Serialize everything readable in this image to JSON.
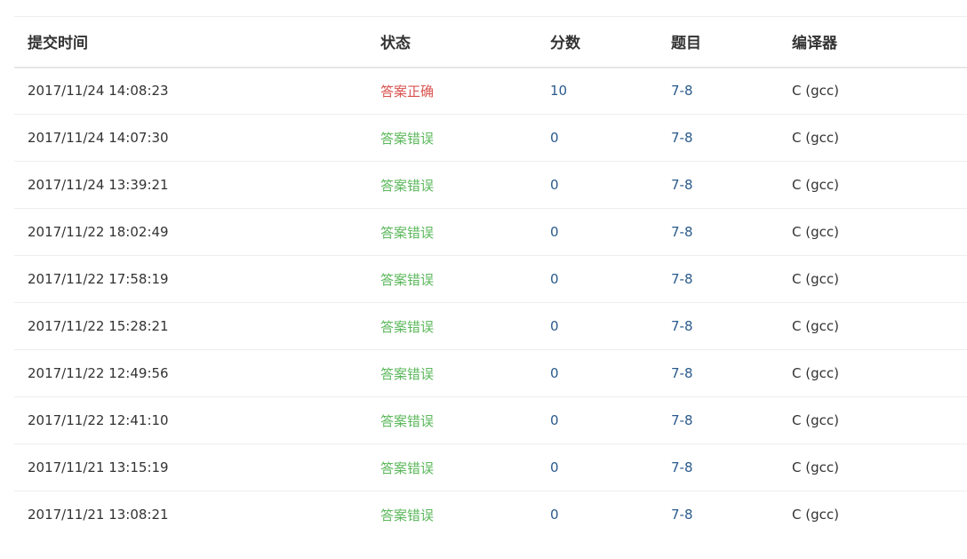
{
  "colors": {
    "accepted": "#d9534f",
    "wrong_answer": "#5cb85c",
    "link": "#2a5a8c"
  },
  "table": {
    "headers": [
      "提交时间",
      "状态",
      "分数",
      "题目",
      "编译器"
    ],
    "rows": [
      {
        "time": "2017/11/24 14:08:23",
        "status": "答案正确",
        "status_type": "accepted",
        "score": "10",
        "problem": "7-8",
        "compiler": "C (gcc)"
      },
      {
        "time": "2017/11/24 14:07:30",
        "status": "答案错误",
        "status_type": "wrong_answer",
        "score": "0",
        "problem": "7-8",
        "compiler": "C (gcc)"
      },
      {
        "time": "2017/11/24 13:39:21",
        "status": "答案错误",
        "status_type": "wrong_answer",
        "score": "0",
        "problem": "7-8",
        "compiler": "C (gcc)"
      },
      {
        "time": "2017/11/22 18:02:49",
        "status": "答案错误",
        "status_type": "wrong_answer",
        "score": "0",
        "problem": "7-8",
        "compiler": "C (gcc)"
      },
      {
        "time": "2017/11/22 17:58:19",
        "status": "答案错误",
        "status_type": "wrong_answer",
        "score": "0",
        "problem": "7-8",
        "compiler": "C (gcc)"
      },
      {
        "time": "2017/11/22 15:28:21",
        "status": "答案错误",
        "status_type": "wrong_answer",
        "score": "0",
        "problem": "7-8",
        "compiler": "C (gcc)"
      },
      {
        "time": "2017/11/22 12:49:56",
        "status": "答案错误",
        "status_type": "wrong_answer",
        "score": "0",
        "problem": "7-8",
        "compiler": "C (gcc)"
      },
      {
        "time": "2017/11/22 12:41:10",
        "status": "答案错误",
        "status_type": "wrong_answer",
        "score": "0",
        "problem": "7-8",
        "compiler": "C (gcc)"
      },
      {
        "time": "2017/11/21 13:15:19",
        "status": "答案错误",
        "status_type": "wrong_answer",
        "score": "0",
        "problem": "7-8",
        "compiler": "C (gcc)"
      },
      {
        "time": "2017/11/21 13:08:21",
        "status": "答案错误",
        "status_type": "wrong_answer",
        "score": "0",
        "problem": "7-8",
        "compiler": "C (gcc)"
      }
    ]
  }
}
